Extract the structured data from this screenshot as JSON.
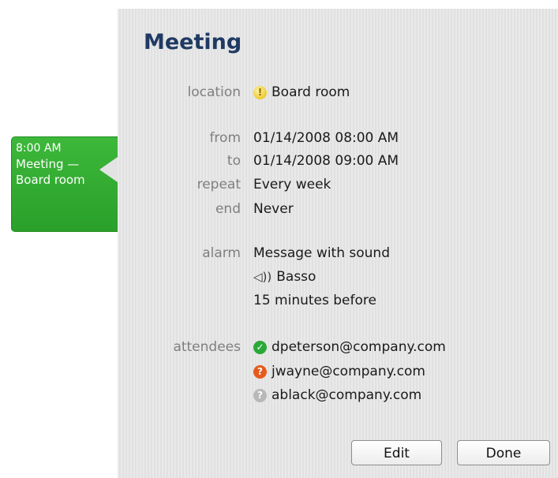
{
  "event_chip": {
    "time": "8:00 AM",
    "line1": "Meeting —",
    "line2": "Board room",
    "color": "#2aa02a"
  },
  "panel": {
    "title": "Meeting",
    "location": {
      "label": "location",
      "value": "Board room",
      "icon": "warning-icon"
    },
    "from": {
      "label": "from",
      "value": "01/14/2008 08:00 AM"
    },
    "to": {
      "label": "to",
      "value": "01/14/2008 09:00 AM"
    },
    "repeat": {
      "label": "repeat",
      "value": "Every week"
    },
    "end": {
      "label": "end",
      "value": "Never"
    },
    "alarm": {
      "label": "alarm",
      "type": "Message with sound",
      "sound": "Basso",
      "timing": "15  minutes before"
    },
    "attendees": {
      "label": "attendees",
      "items": [
        {
          "email": "dpeterson@company.com",
          "status_icon": "accepted-icon",
          "color": "#2aa838"
        },
        {
          "email": "jwayne@company.com",
          "status_icon": "tentative-icon",
          "color": "#e55a1c"
        },
        {
          "email": "ablack@company.com",
          "status_icon": "no-response-icon",
          "color": "#b8b8b8"
        }
      ]
    },
    "buttons": {
      "edit": "Edit",
      "done": "Done"
    }
  }
}
